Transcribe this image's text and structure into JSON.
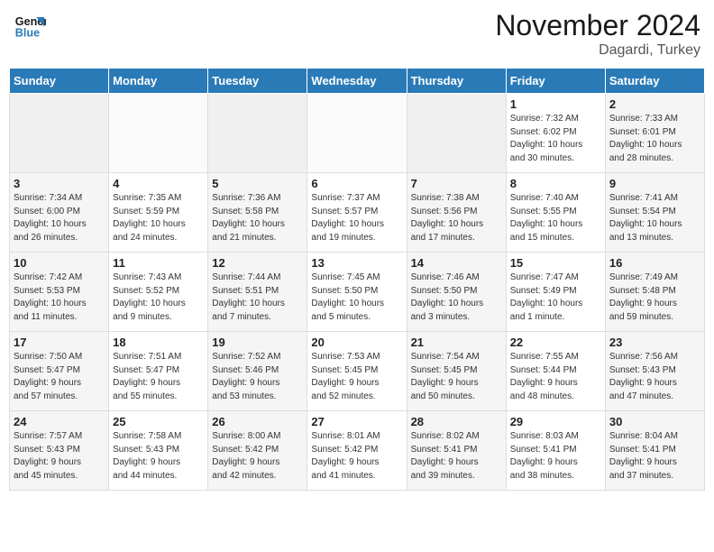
{
  "header": {
    "logo_line1": "General",
    "logo_line2": "Blue",
    "month": "November 2024",
    "location": "Dagardi, Turkey"
  },
  "weekdays": [
    "Sunday",
    "Monday",
    "Tuesday",
    "Wednesday",
    "Thursday",
    "Friday",
    "Saturday"
  ],
  "weeks": [
    [
      {
        "day": "",
        "info": ""
      },
      {
        "day": "",
        "info": ""
      },
      {
        "day": "",
        "info": ""
      },
      {
        "day": "",
        "info": ""
      },
      {
        "day": "",
        "info": ""
      },
      {
        "day": "1",
        "info": "Sunrise: 7:32 AM\nSunset: 6:02 PM\nDaylight: 10 hours\nand 30 minutes."
      },
      {
        "day": "2",
        "info": "Sunrise: 7:33 AM\nSunset: 6:01 PM\nDaylight: 10 hours\nand 28 minutes."
      }
    ],
    [
      {
        "day": "3",
        "info": "Sunrise: 7:34 AM\nSunset: 6:00 PM\nDaylight: 10 hours\nand 26 minutes."
      },
      {
        "day": "4",
        "info": "Sunrise: 7:35 AM\nSunset: 5:59 PM\nDaylight: 10 hours\nand 24 minutes."
      },
      {
        "day": "5",
        "info": "Sunrise: 7:36 AM\nSunset: 5:58 PM\nDaylight: 10 hours\nand 21 minutes."
      },
      {
        "day": "6",
        "info": "Sunrise: 7:37 AM\nSunset: 5:57 PM\nDaylight: 10 hours\nand 19 minutes."
      },
      {
        "day": "7",
        "info": "Sunrise: 7:38 AM\nSunset: 5:56 PM\nDaylight: 10 hours\nand 17 minutes."
      },
      {
        "day": "8",
        "info": "Sunrise: 7:40 AM\nSunset: 5:55 PM\nDaylight: 10 hours\nand 15 minutes."
      },
      {
        "day": "9",
        "info": "Sunrise: 7:41 AM\nSunset: 5:54 PM\nDaylight: 10 hours\nand 13 minutes."
      }
    ],
    [
      {
        "day": "10",
        "info": "Sunrise: 7:42 AM\nSunset: 5:53 PM\nDaylight: 10 hours\nand 11 minutes."
      },
      {
        "day": "11",
        "info": "Sunrise: 7:43 AM\nSunset: 5:52 PM\nDaylight: 10 hours\nand 9 minutes."
      },
      {
        "day": "12",
        "info": "Sunrise: 7:44 AM\nSunset: 5:51 PM\nDaylight: 10 hours\nand 7 minutes."
      },
      {
        "day": "13",
        "info": "Sunrise: 7:45 AM\nSunset: 5:50 PM\nDaylight: 10 hours\nand 5 minutes."
      },
      {
        "day": "14",
        "info": "Sunrise: 7:46 AM\nSunset: 5:50 PM\nDaylight: 10 hours\nand 3 minutes."
      },
      {
        "day": "15",
        "info": "Sunrise: 7:47 AM\nSunset: 5:49 PM\nDaylight: 10 hours\nand 1 minute."
      },
      {
        "day": "16",
        "info": "Sunrise: 7:49 AM\nSunset: 5:48 PM\nDaylight: 9 hours\nand 59 minutes."
      }
    ],
    [
      {
        "day": "17",
        "info": "Sunrise: 7:50 AM\nSunset: 5:47 PM\nDaylight: 9 hours\nand 57 minutes."
      },
      {
        "day": "18",
        "info": "Sunrise: 7:51 AM\nSunset: 5:47 PM\nDaylight: 9 hours\nand 55 minutes."
      },
      {
        "day": "19",
        "info": "Sunrise: 7:52 AM\nSunset: 5:46 PM\nDaylight: 9 hours\nand 53 minutes."
      },
      {
        "day": "20",
        "info": "Sunrise: 7:53 AM\nSunset: 5:45 PM\nDaylight: 9 hours\nand 52 minutes."
      },
      {
        "day": "21",
        "info": "Sunrise: 7:54 AM\nSunset: 5:45 PM\nDaylight: 9 hours\nand 50 minutes."
      },
      {
        "day": "22",
        "info": "Sunrise: 7:55 AM\nSunset: 5:44 PM\nDaylight: 9 hours\nand 48 minutes."
      },
      {
        "day": "23",
        "info": "Sunrise: 7:56 AM\nSunset: 5:43 PM\nDaylight: 9 hours\nand 47 minutes."
      }
    ],
    [
      {
        "day": "24",
        "info": "Sunrise: 7:57 AM\nSunset: 5:43 PM\nDaylight: 9 hours\nand 45 minutes."
      },
      {
        "day": "25",
        "info": "Sunrise: 7:58 AM\nSunset: 5:43 PM\nDaylight: 9 hours\nand 44 minutes."
      },
      {
        "day": "26",
        "info": "Sunrise: 8:00 AM\nSunset: 5:42 PM\nDaylight: 9 hours\nand 42 minutes."
      },
      {
        "day": "27",
        "info": "Sunrise: 8:01 AM\nSunset: 5:42 PM\nDaylight: 9 hours\nand 41 minutes."
      },
      {
        "day": "28",
        "info": "Sunrise: 8:02 AM\nSunset: 5:41 PM\nDaylight: 9 hours\nand 39 minutes."
      },
      {
        "day": "29",
        "info": "Sunrise: 8:03 AM\nSunset: 5:41 PM\nDaylight: 9 hours\nand 38 minutes."
      },
      {
        "day": "30",
        "info": "Sunrise: 8:04 AM\nSunset: 5:41 PM\nDaylight: 9 hours\nand 37 minutes."
      }
    ]
  ]
}
